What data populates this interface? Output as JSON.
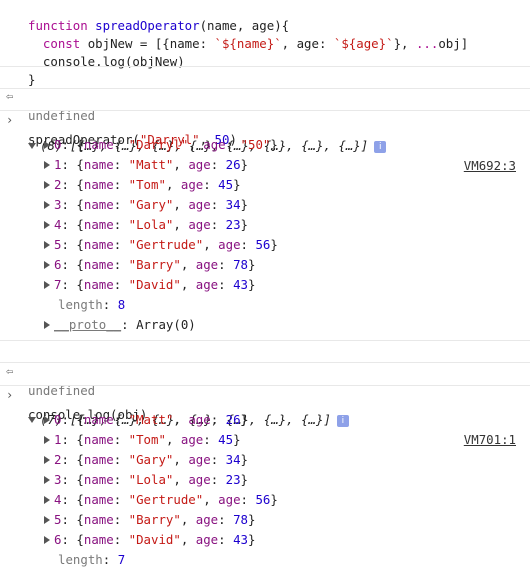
{
  "code": {
    "line1": "function spreadOperator(name, age){",
    "line2": "  const objNew = [{name: `${name}`, age: `${age}`}, ...obj]",
    "line3": "  console.log(objNew)",
    "line4": "}"
  },
  "icons": {
    "result": "return-arrow-icon",
    "prompt": "chevron-right-icon",
    "expand": "disclosure-triangle-icon",
    "info": "info-icon"
  },
  "results": [
    "undefined",
    "undefined"
  ],
  "commands": [
    "spreadOperator(\"Darryl\", 50)",
    "console.log(obj)"
  ],
  "output1": {
    "summary": "(8) [{…}, {…}, {…}, {…}, {…}, {…}, {…}, {…}]",
    "source": "VM692:3",
    "items": [
      {
        "idx": "0",
        "name": "\"Darryl\"",
        "age": "\"50\"",
        "age_is_string": true
      },
      {
        "idx": "1",
        "name": "\"Matt\"",
        "age": "26"
      },
      {
        "idx": "2",
        "name": "\"Tom\"",
        "age": "45"
      },
      {
        "idx": "3",
        "name": "\"Gary\"",
        "age": "34"
      },
      {
        "idx": "4",
        "name": "\"Lola\"",
        "age": "23"
      },
      {
        "idx": "5",
        "name": "\"Gertrude\"",
        "age": "56"
      },
      {
        "idx": "6",
        "name": "\"Barry\"",
        "age": "78"
      },
      {
        "idx": "7",
        "name": "\"David\"",
        "age": "43"
      }
    ],
    "length_label": "length",
    "length": "8",
    "proto": "__proto__",
    "proto_value": "Array(0)"
  },
  "output2": {
    "summary": "(7) [{…}, {…}, {…}, {…}, {…}, {…}, {…}]",
    "source": "VM701:1",
    "items": [
      {
        "idx": "0",
        "name": "\"Matt\"",
        "age": "26"
      },
      {
        "idx": "1",
        "name": "\"Tom\"",
        "age": "45"
      },
      {
        "idx": "2",
        "name": "\"Gary\"",
        "age": "34"
      },
      {
        "idx": "3",
        "name": "\"Lola\"",
        "age": "23"
      },
      {
        "idx": "4",
        "name": "\"Gertrude\"",
        "age": "56"
      },
      {
        "idx": "5",
        "name": "\"Barry\"",
        "age": "78"
      },
      {
        "idx": "6",
        "name": "\"David\"",
        "age": "43"
      }
    ],
    "length_label": "length",
    "length": "7"
  },
  "labels": {
    "name_key": "name",
    "age_key": "age",
    "info_glyph": "i"
  }
}
